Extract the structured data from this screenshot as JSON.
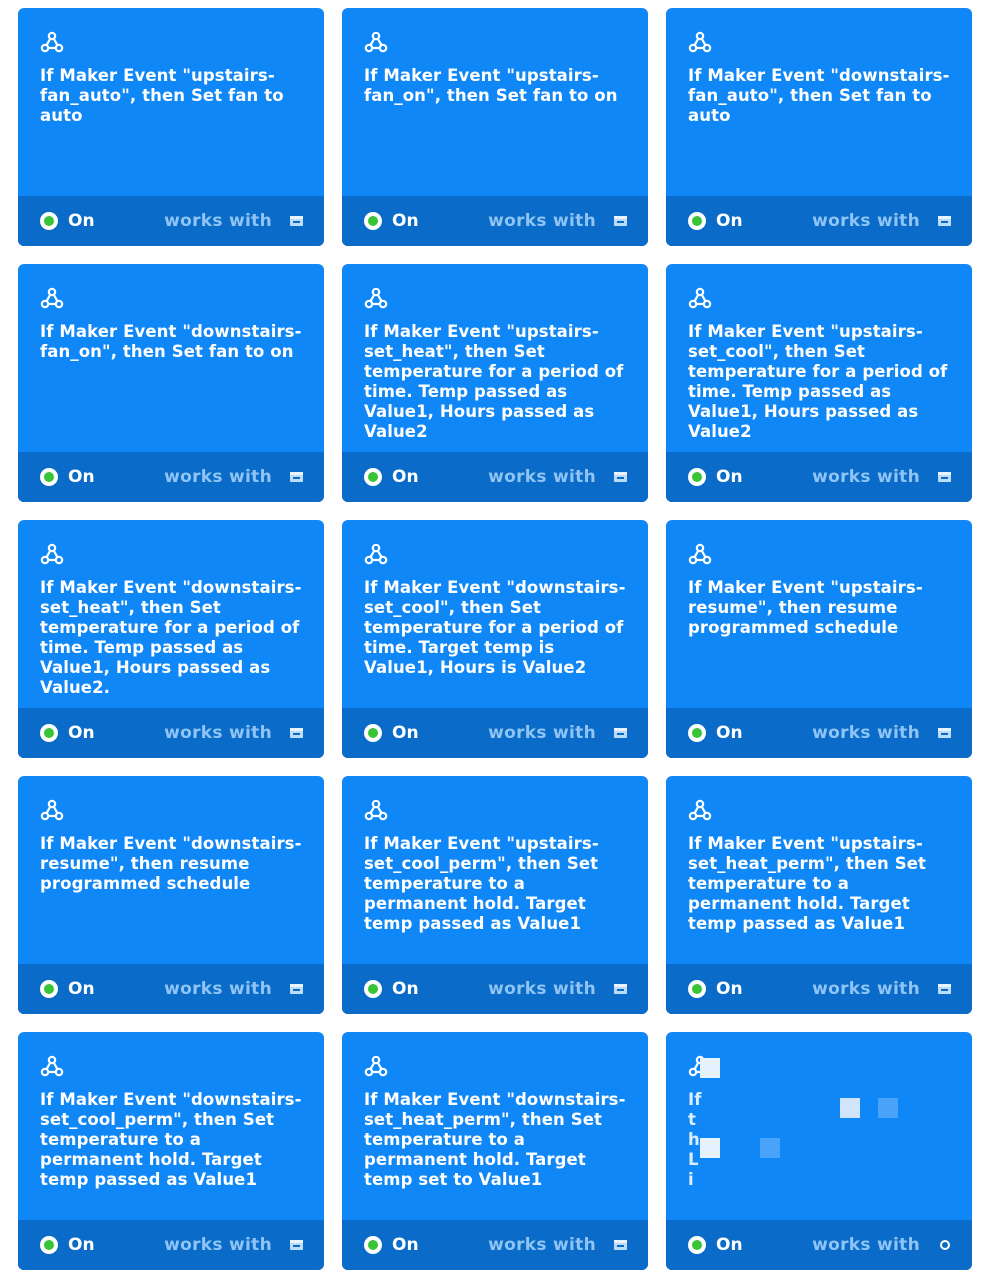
{
  "cards": [
    {
      "title": "If Maker Event \"upstairs-fan_auto\", then Set fan to auto",
      "status": "On",
      "works_with": "works with"
    },
    {
      "title": "If Maker Event \"upstairs-fan_on\", then Set fan to on",
      "status": "On",
      "works_with": "works with"
    },
    {
      "title": "If Maker Event \"downstairs-fan_auto\", then Set fan to auto",
      "status": "On",
      "works_with": "works with"
    },
    {
      "title": "If Maker Event \"downstairs-fan_on\", then Set fan to on",
      "status": "On",
      "works_with": "works with"
    },
    {
      "title": "If Maker Event \"upstairs-set_heat\", then Set temperature for a period of time. Temp passed as Value1, Hours passed as Value2",
      "status": "On",
      "works_with": "works with"
    },
    {
      "title": "If Maker Event \"upstairs-set_cool\", then Set temperature for a period of time. Temp passed as Value1, Hours passed as Value2",
      "status": "On",
      "works_with": "works with"
    },
    {
      "title": "If Maker Event \"downstairs-set_heat\", then Set temperature for a period of time. Temp passed as Value1, Hours passed as Value2.",
      "status": "On",
      "works_with": "works with"
    },
    {
      "title": "If Maker Event \"downstairs-set_cool\", then Set temperature for a period of time. Target temp is Value1, Hours is Value2",
      "status": "On",
      "works_with": "works with"
    },
    {
      "title": "If Maker Event \"upstairs-resume\", then resume programmed schedule",
      "status": "On",
      "works_with": "works with"
    },
    {
      "title": "If Maker Event \"downstairs-resume\", then resume programmed schedule",
      "status": "On",
      "works_with": "works with"
    },
    {
      "title": "If Maker Event \"upstairs-set_cool_perm\", then Set temperature to a permanent hold. Target temp passed as Value1",
      "status": "On",
      "works_with": "works with"
    },
    {
      "title": "If Maker Event \"upstairs-set_heat_perm\", then Set temperature to a permanent hold. Target temp passed as Value1",
      "status": "On",
      "works_with": "works with"
    },
    {
      "title": "If Maker Event \"downstairs-set_cool_perm\", then Set temperature to a permanent hold. Target temp passed as Value1",
      "status": "On",
      "works_with": "works with"
    },
    {
      "title": "If Maker Event \"downstairs-set_heat_perm\", then Set temperature to a permanent hold. Target temp set to Value1",
      "status": "On",
      "works_with": "works with"
    },
    {
      "title": "If th Li",
      "status": "On",
      "works_with": "works with",
      "obscured": true
    }
  ],
  "colors": {
    "card_bg": "#0f87f7",
    "footer_bg": "#0a6cc8",
    "status_on": "#37c437",
    "works_with_text": "#8fc4f5"
  },
  "icons": {
    "card_icon": "webhooks-icon",
    "status_icon": "status-on-dot-icon",
    "works_with_icon": "service-icon"
  }
}
